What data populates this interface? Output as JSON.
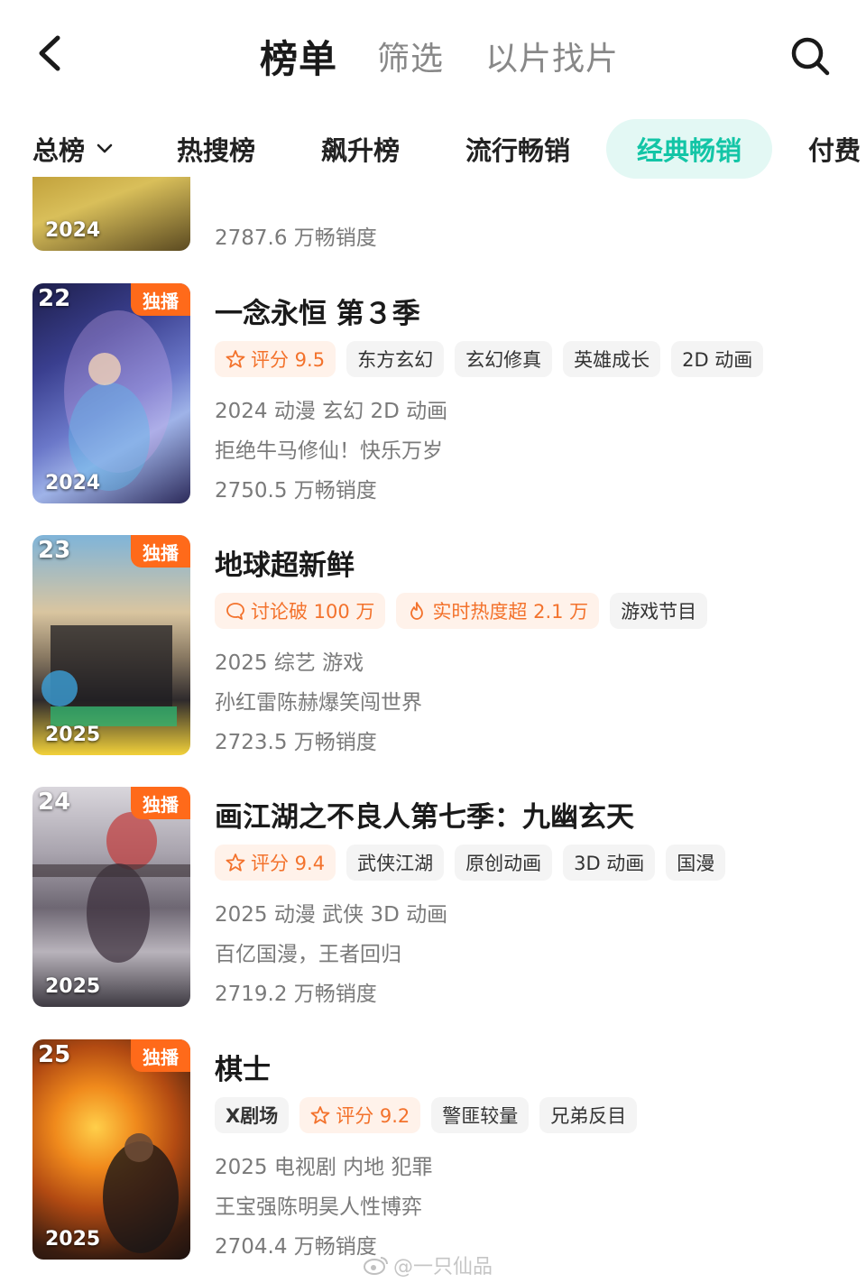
{
  "header": {
    "tabs": [
      "榜单",
      "筛选",
      "以片找片"
    ]
  },
  "categories": [
    {
      "label": "总榜"
    },
    {
      "label": "热搜榜"
    },
    {
      "label": "飙升榜"
    },
    {
      "label": "流行畅销"
    },
    {
      "label": "经典畅销"
    },
    {
      "label": "付费"
    }
  ],
  "prev_item": {
    "year": "2024",
    "sales": "2787.6 万畅销度"
  },
  "items": [
    {
      "rank": "22",
      "badge": "独播",
      "year": "2024",
      "title": "一念永恒 第３季",
      "tags": [
        "评分 9.5",
        "东方玄幻",
        "玄幻修真",
        "英雄成长",
        "2D 动画"
      ],
      "info": "2024 动漫 玄幻 2D 动画",
      "slogan": "拒绝牛马修仙！快乐万岁",
      "sales": "2750.5 万畅销度"
    },
    {
      "rank": "23",
      "badge": "独播",
      "year": "2025",
      "title": "地球超新鲜",
      "tags": [
        "讨论破 100 万",
        "实时热度超 2.1 万",
        "游戏节目"
      ],
      "info": "2025 综艺 游戏",
      "slogan": "孙红雷陈赫爆笑闯世界",
      "sales": "2723.5 万畅销度"
    },
    {
      "rank": "24",
      "badge": "独播",
      "year": "2025",
      "title": "画江湖之不良人第七季：九幽玄天",
      "tags": [
        "评分 9.4",
        "武侠江湖",
        "原创动画",
        "3D 动画",
        "国漫"
      ],
      "info": "2025 动漫 武侠 3D 动画",
      "slogan": "百亿国漫，王者回归",
      "sales": "2719.2 万畅销度"
    },
    {
      "rank": "25",
      "badge": "独播",
      "year": "2025",
      "title": "棋士",
      "tags": [
        "X剧场",
        "评分 9.2",
        "警匪较量",
        "兄弟反目"
      ],
      "info": "2025 电视剧 内地 犯罪",
      "slogan": "王宝强陈明昊人性博弈",
      "sales": "2704.4 万畅销度"
    }
  ],
  "watermark": "@一只仙品",
  "colors": {
    "accent": "#13c5a6",
    "accent_bg": "#e3f8f4",
    "badge": "#ff6a1a",
    "highlight_tag": "#f3722c"
  }
}
